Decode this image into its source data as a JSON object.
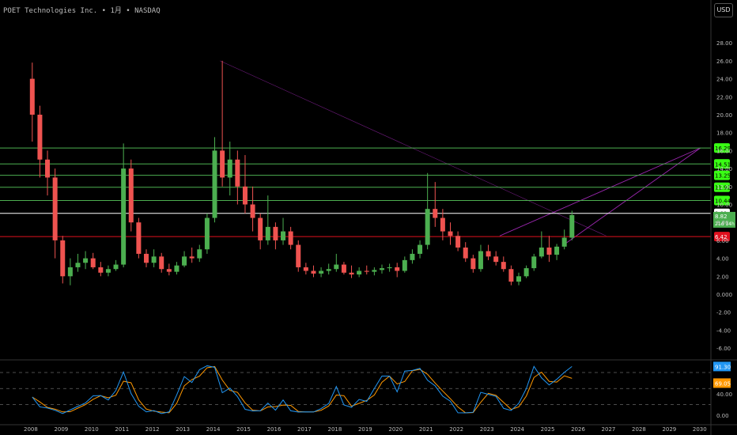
{
  "header": {
    "title": "POET Technologies Inc. • 1月 • NASDAQ",
    "currency_button": "USD"
  },
  "colors": {
    "up": "#26a69a",
    "up_candle": "#4caf50",
    "down": "#ef5350",
    "level_green": "#4caf50",
    "level_label_green": "#39ff14",
    "level_white": "#ffffff",
    "level_red": "#e0101e",
    "trend_purple": "#9c27b0",
    "osc_k": "#2196f3",
    "osc_d": "#ff9800"
  },
  "chart_data": [
    {
      "type": "candlestick",
      "x_ticks": [
        "2008",
        "2009",
        "2010",
        "2011",
        "2012",
        "2013",
        "2014",
        "2015",
        "2016",
        "2017",
        "2018",
        "2019",
        "2020",
        "2021",
        "2022",
        "2023",
        "2024",
        "2025",
        "2026",
        "2027",
        "2028",
        "2029",
        "2030"
      ],
      "y_ticks": [
        "28.00",
        "26.00",
        "24.00",
        "22.00",
        "20.00",
        "18.00",
        "16.00",
        "14.00",
        "12.00",
        "10.00",
        "8.00",
        "6.00",
        "4.00",
        "2.00",
        "0.000",
        "-2.00",
        "-4.00",
        "-6.00"
      ],
      "ylim": [
        -7,
        29
      ],
      "xlim": [
        2007.8,
        2030.5
      ],
      "candles_quarterly": [
        [
          "2008Q1",
          24,
          25.8,
          17,
          20
        ],
        [
          "2008Q2",
          20,
          21,
          13,
          15
        ],
        [
          "2008Q3",
          15,
          16,
          11,
          13
        ],
        [
          "2008Q4",
          13,
          14,
          4,
          6
        ],
        [
          "2009Q1",
          6,
          6.5,
          1.2,
          2
        ],
        [
          "2009Q2",
          2,
          4,
          1,
          3
        ],
        [
          "2009Q3",
          3,
          4.5,
          2.5,
          3.5
        ],
        [
          "2009Q4",
          3.5,
          4.8,
          2.8,
          4
        ],
        [
          "2010Q1",
          4,
          4.6,
          2.8,
          3
        ],
        [
          "2010Q2",
          3,
          3.6,
          2,
          2.4
        ],
        [
          "2010Q3",
          2.4,
          3.2,
          2,
          2.8
        ],
        [
          "2010Q4",
          2.8,
          3.8,
          2.6,
          3.3
        ],
        [
          "2011Q1",
          3.3,
          16.8,
          3,
          14
        ],
        [
          "2011Q2",
          14,
          15,
          7,
          8
        ],
        [
          "2011Q3",
          8,
          8.5,
          4,
          4.5
        ],
        [
          "2011Q4",
          4.5,
          5,
          3,
          3.5
        ],
        [
          "2012Q1",
          3.5,
          5,
          3,
          4.2
        ],
        [
          "2012Q2",
          4.2,
          4.6,
          2.4,
          2.8
        ],
        [
          "2012Q3",
          2.8,
          3.4,
          2.1,
          2.5
        ],
        [
          "2012Q4",
          2.5,
          3.6,
          2.2,
          3.2
        ],
        [
          "2013Q1",
          3.2,
          4.8,
          3,
          4.2
        ],
        [
          "2013Q2",
          4.2,
          5.2,
          3.5,
          4
        ],
        [
          "2013Q3",
          4,
          5.5,
          3.6,
          5
        ],
        [
          "2013Q4",
          5,
          9,
          4.5,
          8.5
        ],
        [
          "2014Q1",
          8.5,
          17.5,
          8,
          16
        ],
        [
          "2014Q2",
          16,
          26,
          12,
          13
        ],
        [
          "2014Q3",
          13,
          17,
          11,
          15
        ],
        [
          "2014Q4",
          15,
          16,
          10,
          12
        ],
        [
          "2015Q1",
          12,
          15.5,
          9,
          10
        ],
        [
          "2015Q2",
          10,
          12,
          7,
          8.5
        ],
        [
          "2015Q3",
          8.5,
          9,
          5,
          6
        ],
        [
          "2015Q4",
          6,
          11,
          5.5,
          7.5
        ],
        [
          "2016Q1",
          7.5,
          8,
          5,
          6
        ],
        [
          "2016Q2",
          6,
          8.5,
          5.5,
          7
        ],
        [
          "2016Q3",
          7,
          7.5,
          5,
          5.5
        ],
        [
          "2016Q4",
          5.5,
          6,
          2.5,
          3
        ],
        [
          "2017Q1",
          3,
          3.5,
          2.2,
          2.6
        ],
        [
          "2017Q2",
          2.6,
          3.2,
          1.9,
          2.3
        ],
        [
          "2017Q3",
          2.3,
          3,
          1.9,
          2.6
        ],
        [
          "2017Q4",
          2.6,
          3.4,
          2.2,
          2.8
        ],
        [
          "2018Q1",
          2.8,
          4.5,
          2.5,
          3.3
        ],
        [
          "2018Q2",
          3.3,
          3.6,
          2.2,
          2.4
        ],
        [
          "2018Q3",
          2.4,
          3.2,
          1.8,
          2.2
        ],
        [
          "2018Q4",
          2.2,
          3,
          1.9,
          2.6
        ],
        [
          "2019Q1",
          2.6,
          3.2,
          2.2,
          2.5
        ],
        [
          "2019Q2",
          2.5,
          3,
          2.1,
          2.7
        ],
        [
          "2019Q3",
          2.7,
          3.3,
          2.3,
          2.9
        ],
        [
          "2019Q4",
          2.9,
          3.4,
          2.5,
          3
        ],
        [
          "2020Q1",
          3,
          3.5,
          1.9,
          2.6
        ],
        [
          "2020Q2",
          2.6,
          4.2,
          2.4,
          3.8
        ],
        [
          "2020Q3",
          3.8,
          5,
          3.4,
          4.5
        ],
        [
          "2020Q4",
          4.5,
          6,
          4,
          5.5
        ],
        [
          "2021Q1",
          5.5,
          13.5,
          5,
          9.5
        ],
        [
          "2021Q2",
          9.5,
          12.5,
          7.5,
          8.5
        ],
        [
          "2021Q3",
          8.5,
          9.5,
          6,
          7
        ],
        [
          "2021Q4",
          7,
          8,
          5.5,
          6.5
        ],
        [
          "2022Q1",
          6.5,
          7,
          4.8,
          5.2
        ],
        [
          "2022Q2",
          5.2,
          5.8,
          3.6,
          4
        ],
        [
          "2022Q3",
          4,
          4.4,
          2.4,
          2.8
        ],
        [
          "2022Q4",
          2.8,
          5.5,
          2.5,
          4.8
        ],
        [
          "2023Q1",
          4.8,
          5.5,
          3.8,
          4.2
        ],
        [
          "2023Q2",
          4.2,
          4.8,
          3.2,
          3.6
        ],
        [
          "2023Q3",
          3.6,
          4.2,
          2.5,
          2.8
        ],
        [
          "2023Q4",
          2.8,
          3.2,
          1,
          1.4
        ],
        [
          "2024Q1",
          1.4,
          2.4,
          1,
          2
        ],
        [
          "2024Q2",
          2,
          3.2,
          1.8,
          2.9
        ],
        [
          "2024Q3",
          2.9,
          4.5,
          2.6,
          4.2
        ],
        [
          "2024Q4",
          4.2,
          7,
          4,
          5.2
        ],
        [
          "2025Q1",
          5.2,
          6.5,
          3.6,
          4.4
        ],
        [
          "2025Q2",
          4.4,
          5.6,
          3.8,
          5.3
        ],
        [
          "2025Q3",
          5.3,
          7.2,
          5,
          6.3
        ],
        [
          "2025Q4",
          6.3,
          9.3,
          6,
          8.82
        ]
      ],
      "levels": [
        {
          "value": 16.29,
          "label": "16.29",
          "kind": "green"
        },
        {
          "value": 14.51,
          "label": "14.51",
          "kind": "green"
        },
        {
          "value": 13.25,
          "label": "13.25",
          "kind": "green"
        },
        {
          "value": 11.92,
          "label": "11.92",
          "kind": "green"
        },
        {
          "value": 10.44,
          "label": "10.44",
          "kind": "green"
        },
        {
          "value": 9.01,
          "label": "9.01",
          "kind": "white"
        },
        {
          "value": 6.42,
          "label": "6.42",
          "kind": "red"
        }
      ],
      "last_price": {
        "value": 8.82,
        "label": "8.82",
        "countdown": "21d 14h"
      },
      "trendlines": [
        {
          "from": [
            2014.3,
            26.0
          ],
          "to": [
            2027.0,
            6.5
          ],
          "color": "purple-thin"
        },
        {
          "from": [
            2023.5,
            6.5
          ],
          "to": [
            2030.1,
            16.29
          ],
          "color": "purple"
        },
        {
          "from": [
            2025.6,
            5.5
          ],
          "to": [
            2030.1,
            16.29
          ],
          "color": "purple"
        }
      ]
    },
    {
      "type": "line",
      "name": "oscillator",
      "y_ticks": [
        "40.00",
        "0.00"
      ],
      "ylim": [
        0,
        100
      ],
      "dashed_levels": [
        80,
        50,
        20
      ],
      "series": [
        {
          "label": "91.30",
          "last": 91.3,
          "color_key": "osc_k"
        },
        {
          "label": "69.05",
          "last": 69.05,
          "color_key": "osc_d"
        }
      ]
    }
  ]
}
